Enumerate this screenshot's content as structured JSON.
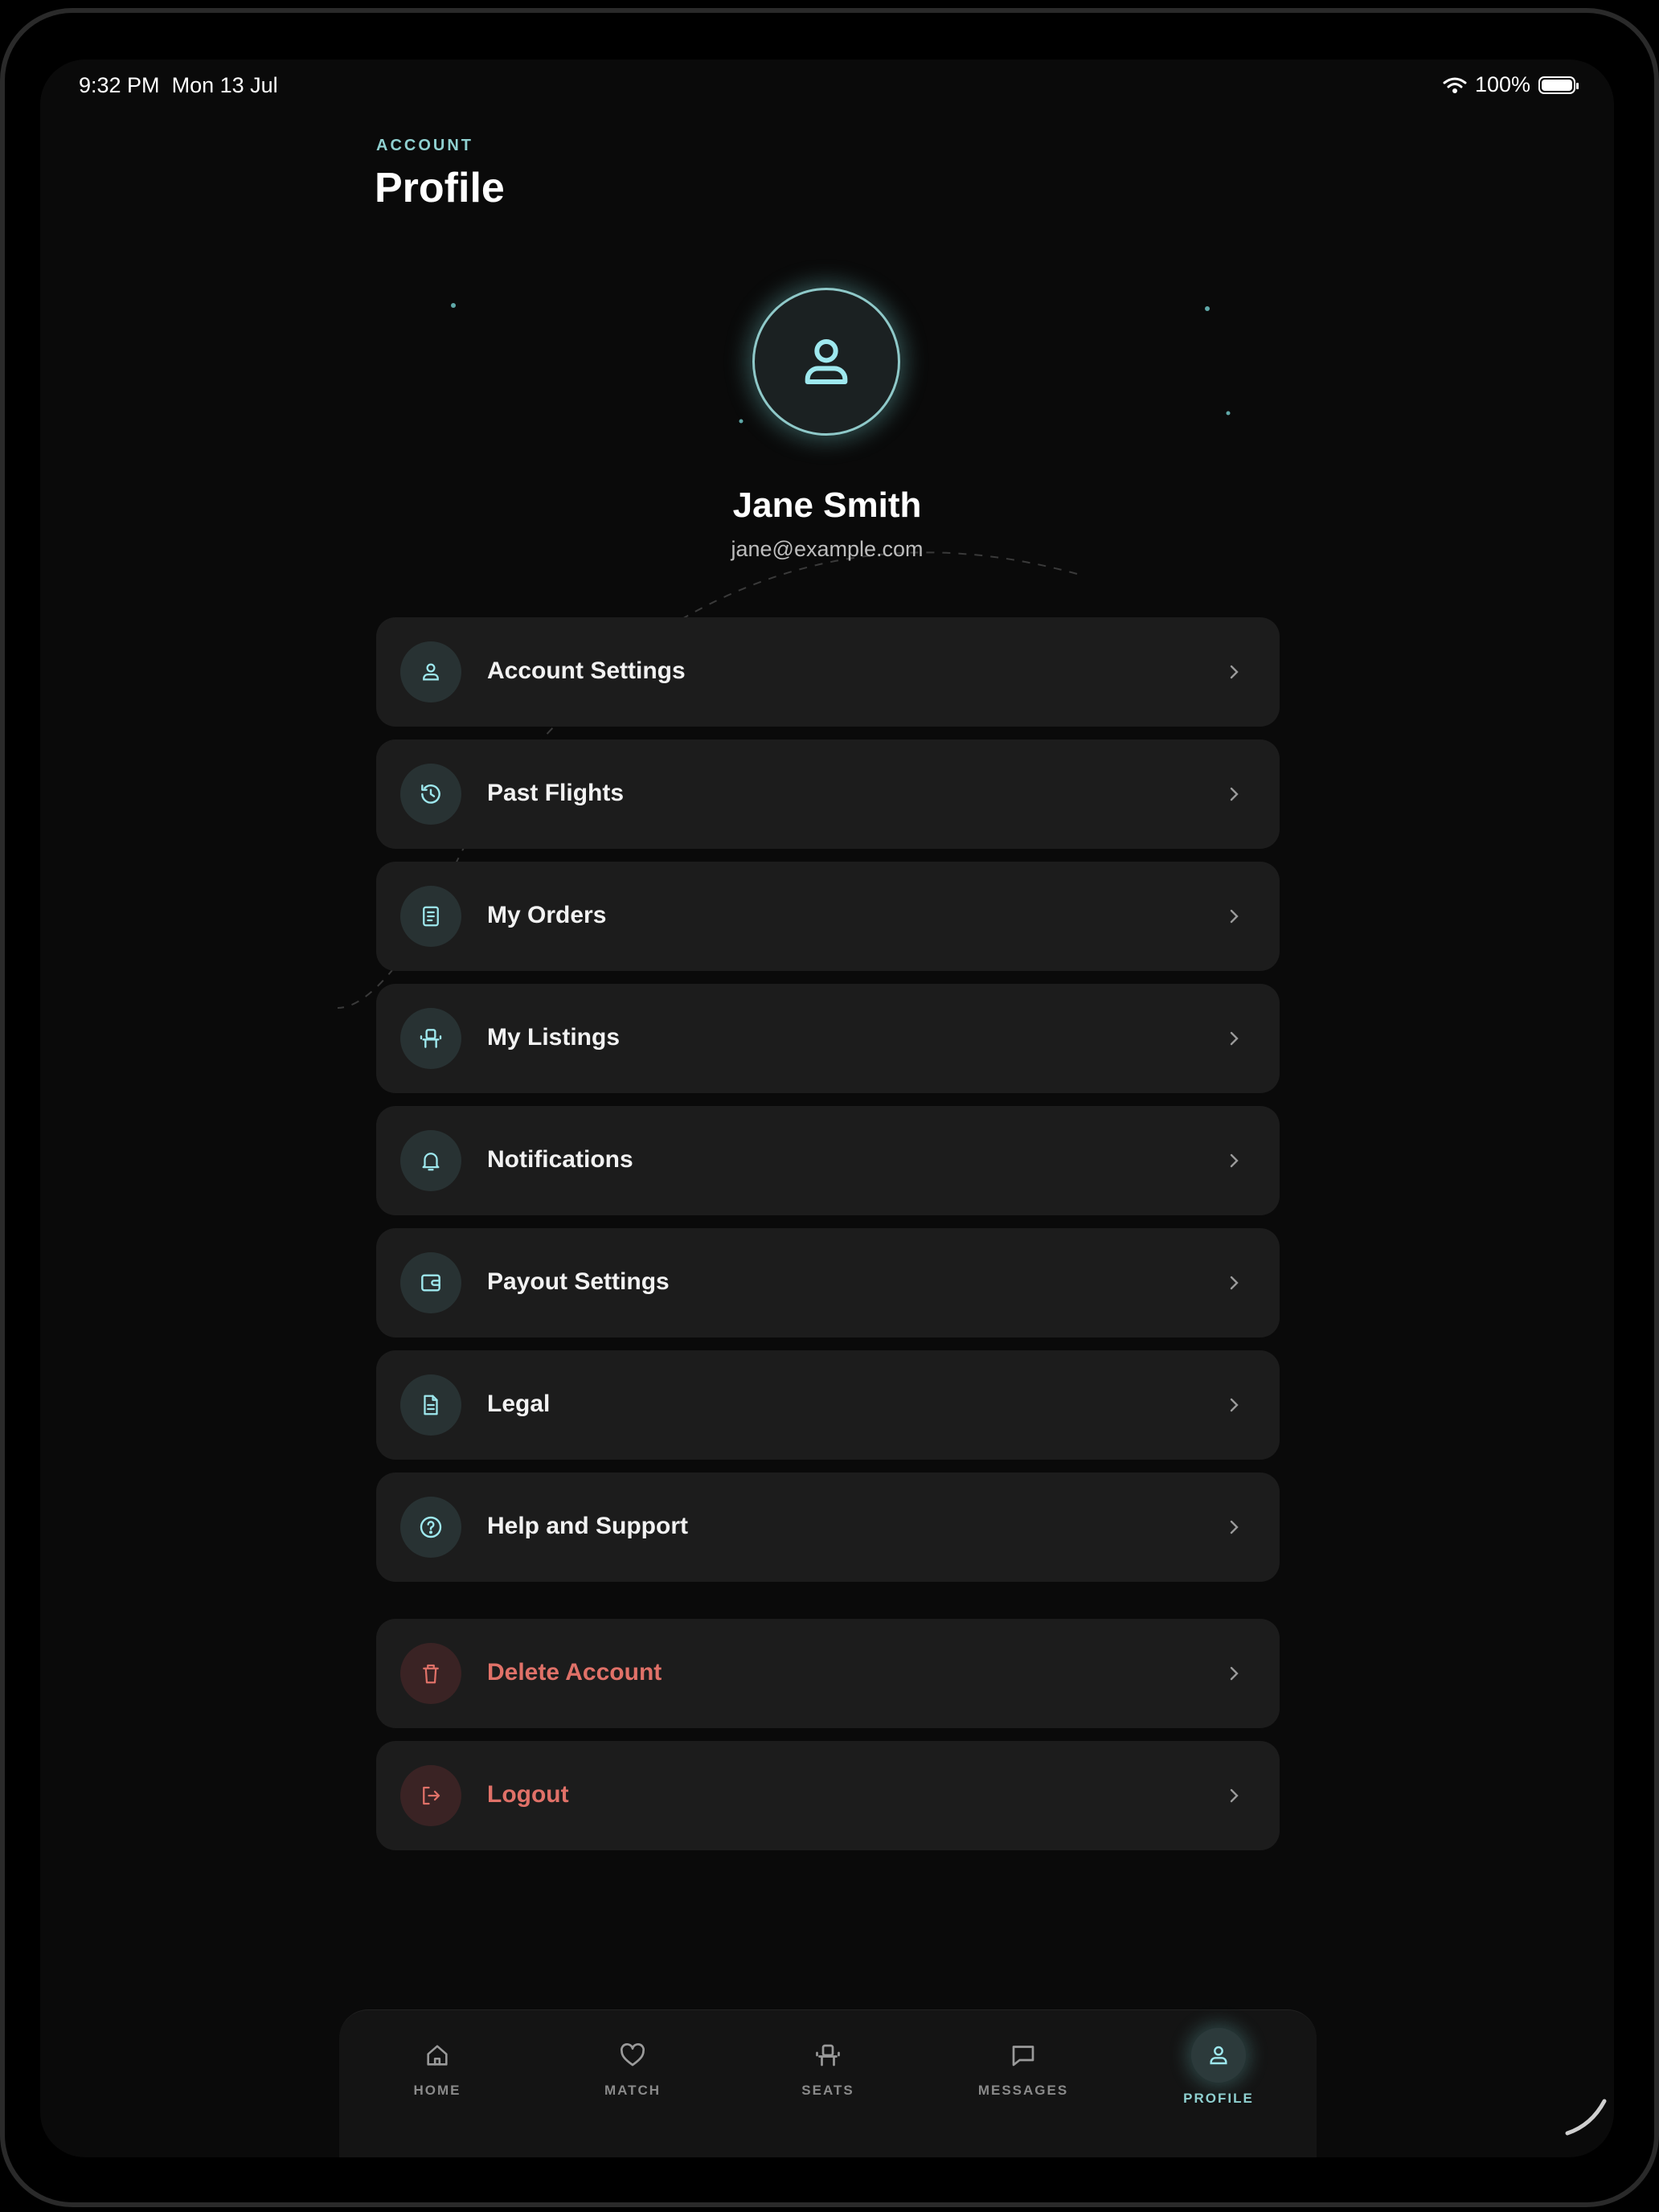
{
  "status_bar": {
    "time": "9:32 PM",
    "date": "Mon 13 Jul",
    "battery": "100%"
  },
  "header": {
    "section": "ACCOUNT",
    "title": "Profile"
  },
  "profile": {
    "name": "Jane Smith",
    "email": "jane@example.com",
    "avatar_icon": "user-icon"
  },
  "menu": {
    "items": [
      {
        "label": "Account Settings",
        "icon": "user-icon"
      },
      {
        "label": "Past Flights",
        "icon": "history-icon"
      },
      {
        "label": "My Orders",
        "icon": "receipt-icon"
      },
      {
        "label": "My Listings",
        "icon": "seat-icon"
      },
      {
        "label": "Notifications",
        "icon": "bell-icon"
      },
      {
        "label": "Payout Settings",
        "icon": "wallet-icon"
      },
      {
        "label": "Legal",
        "icon": "document-icon"
      },
      {
        "label": "Help and Support",
        "icon": "help-circle-icon"
      }
    ],
    "danger_items": [
      {
        "label": "Delete Account",
        "icon": "trash-icon"
      },
      {
        "label": "Logout",
        "icon": "logout-icon"
      }
    ]
  },
  "tabbar": {
    "tabs": [
      {
        "label": "HOME",
        "icon": "home-icon"
      },
      {
        "label": "MATCH",
        "icon": "heart-icon"
      },
      {
        "label": "SEATS",
        "icon": "seat-icon"
      },
      {
        "label": "MESSAGES",
        "icon": "message-icon"
      },
      {
        "label": "PROFILE",
        "icon": "user-icon"
      }
    ],
    "active": "PROFILE"
  },
  "colors": {
    "accent": "#8fd0d0",
    "danger": "#e07168",
    "card": "#1c1c1c",
    "background": "#0a0a0a"
  }
}
